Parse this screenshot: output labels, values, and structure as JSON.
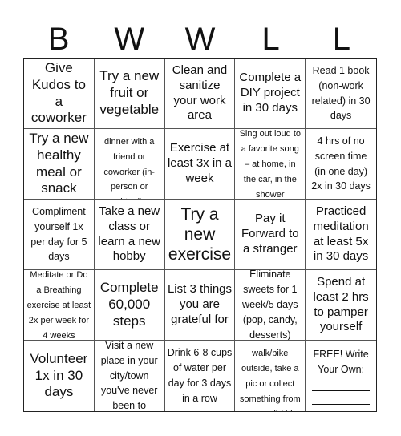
{
  "header": {
    "letters": [
      "B",
      "W",
      "W",
      "L",
      "L"
    ]
  },
  "cells": [
    {
      "text": "Give Kudos to a coworker",
      "size": "l"
    },
    {
      "text": "Try a new fruit or vegetable",
      "size": "l"
    },
    {
      "text": "Clean and sanitize your work area",
      "size": "m"
    },
    {
      "text": "Complete a DIY project in 30 days",
      "size": "m"
    },
    {
      "text": "Read 1 book (non-work related) in 30 days",
      "size": "s"
    },
    {
      "text": "Try a new healthy meal or snack",
      "size": "l"
    },
    {
      "text": "Have lunch or dinner with a friend or coworker (in-person or virtual)",
      "size": "xs"
    },
    {
      "text": "Exercise at least 3x in a week",
      "size": "m"
    },
    {
      "text": "Sing out loud to a favorite song – at home, in the car, in the shower",
      "size": "xs"
    },
    {
      "text": "4 hrs of no screen time (in one day) 2x in 30 days",
      "size": "s"
    },
    {
      "text": "Compliment yourself 1x per day for 5 days",
      "size": "s"
    },
    {
      "text": "Take a new class or learn a new hobby",
      "size": "m"
    },
    {
      "text": "Try a new exercise",
      "size": "xl"
    },
    {
      "text": "Pay it Forward to a stranger",
      "size": "m"
    },
    {
      "text": "Practiced meditation at least 5x in 30 days",
      "size": "m"
    },
    {
      "text": "Meditate or Do a Breathing exercise at least 2x per week for 4 weeks",
      "size": "xs"
    },
    {
      "text": "Complete 60,000 steps",
      "size": "l"
    },
    {
      "text": "List 3 things you are grateful for",
      "size": "m"
    },
    {
      "text": "Eliminate sweets for 1 week/5 days (pop, candy, desserts)",
      "size": "s"
    },
    {
      "text": "Spend at least 2 hrs to pamper yourself",
      "size": "m"
    },
    {
      "text": "Volunteer 1x in 30 days",
      "size": "l"
    },
    {
      "text": "Visit a new place in your city/town you've never been to",
      "size": "s"
    },
    {
      "text": "Drink 6-8 cups of water per day for 3 days in a row",
      "size": "s"
    },
    {
      "text": "Go for a walk/bike outside, take a pic or collect something from your walk/ride",
      "size": "xs"
    },
    {
      "text": "FREE! Write Your Own:",
      "size": "s",
      "free": true
    }
  ]
}
